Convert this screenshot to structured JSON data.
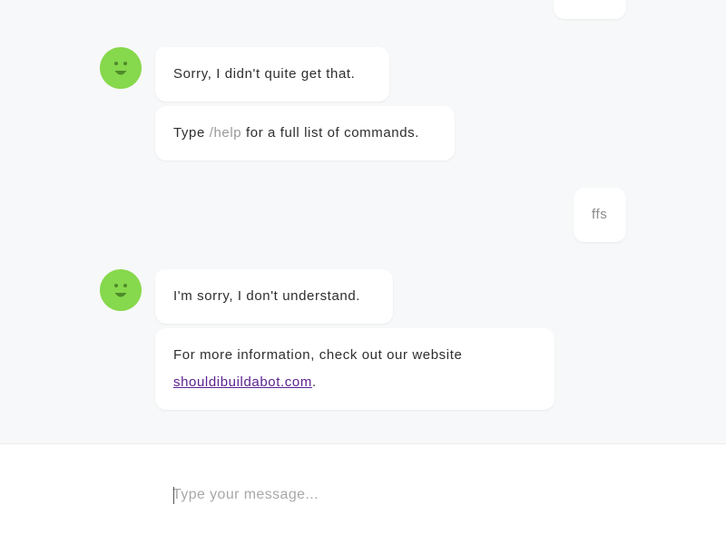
{
  "colors": {
    "avatar": "#86d84c",
    "chat_background": "#f7f8f9",
    "link": "#5a1f8f"
  },
  "conversation": {
    "bot_reply_1": {
      "line_1": "Sorry, I didn't quite get that.",
      "line_2_prefix": "Type ",
      "line_2_command": "/help",
      "line_2_suffix": " for a full list of commands."
    },
    "user_message": "ffs",
    "bot_reply_2": {
      "line_1": "I'm sorry, I don't understand.",
      "line_2_text": "For more information, check out our website",
      "line_2_link": "shouldibuildabot.com",
      "line_2_end": "."
    }
  },
  "composer": {
    "placeholder": "Type your message..."
  },
  "icons": {
    "avatar": "smiley-face-icon"
  }
}
